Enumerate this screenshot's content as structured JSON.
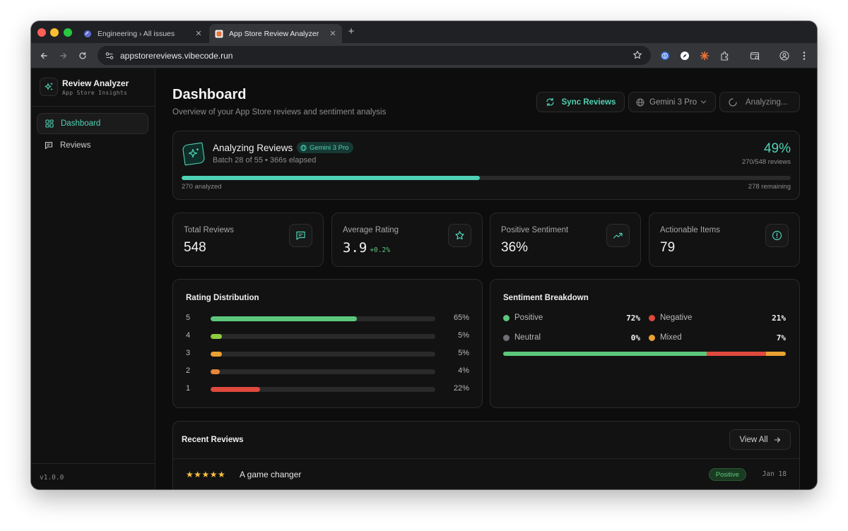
{
  "browser": {
    "tabs": [
      {
        "title": "Engineering › All issues",
        "active": false
      },
      {
        "title": "App Store Review Analyzer",
        "active": true
      }
    ],
    "url": "appstorereviews.vibecode.run"
  },
  "sidebar": {
    "brand_title": "Review Analyzer",
    "brand_subtitle": "App Store Insights",
    "items": [
      {
        "label": "Dashboard",
        "icon": "grid-icon",
        "active": true
      },
      {
        "label": "Reviews",
        "icon": "message-icon",
        "active": false
      }
    ],
    "version": "v1.0.0"
  },
  "header": {
    "title": "Dashboard",
    "subtitle": "Overview of your App Store reviews and sentiment analysis",
    "sync_label": "Sync Reviews",
    "model_label": "Gemini 3 Pro",
    "analyzing_label": "Analyzing..."
  },
  "progress": {
    "title": "Analyzing Reviews",
    "model_badge": "Gemini 3 Pro",
    "batch_text": "Batch 28 of 55 • 366s elapsed",
    "percent_text": "49%",
    "count_text": "270/548 reviews",
    "analyzed_text": "270 analyzed",
    "remaining_text": "278 remaining",
    "fraction": 0.49
  },
  "stats": [
    {
      "label": "Total Reviews",
      "value": "548",
      "delta": "",
      "icon": "message-icon"
    },
    {
      "label": "Average Rating",
      "value": "3.9",
      "delta": "+0.2%",
      "icon": "star-icon"
    },
    {
      "label": "Positive Sentiment",
      "value": "36%",
      "delta": "",
      "icon": "trending-up-icon"
    },
    {
      "label": "Actionable Items",
      "value": "79",
      "delta": "",
      "icon": "alert-circle-icon"
    }
  ],
  "rating_distribution": {
    "title": "Rating Distribution",
    "rows": [
      {
        "star": "5",
        "pct": "65%",
        "value": 65,
        "color": "#5cc77b"
      },
      {
        "star": "4",
        "pct": "5%",
        "value": 5,
        "color": "#8fcb3c"
      },
      {
        "star": "3",
        "pct": "5%",
        "value": 5,
        "color": "#e9a132"
      },
      {
        "star": "2",
        "pct": "4%",
        "value": 4,
        "color": "#e9853a"
      },
      {
        "star": "1",
        "pct": "22%",
        "value": 22,
        "color": "#e0493d"
      }
    ]
  },
  "sentiment": {
    "title": "Sentiment Breakdown",
    "items": [
      {
        "label": "Positive",
        "pct": "72%",
        "value": 72,
        "color": "#5cc77b"
      },
      {
        "label": "Negative",
        "pct": "21%",
        "value": 21,
        "color": "#e0493d"
      },
      {
        "label": "Neutral",
        "pct": "0%",
        "value": 0,
        "color": "#6e6e76"
      },
      {
        "label": "Mixed",
        "pct": "7%",
        "value": 7,
        "color": "#e9a132"
      }
    ]
  },
  "recent": {
    "title": "Recent Reviews",
    "view_all_label": "View All",
    "reviews": [
      {
        "stars": "★★★★★",
        "rating": 5,
        "title": "A game changer",
        "badge": "Positive",
        "date": "Jan 18"
      }
    ]
  },
  "colors": {
    "accent": "#4fd1b5",
    "positive": "#5cc77b",
    "negative": "#e0493d",
    "mixed": "#e9a132"
  }
}
